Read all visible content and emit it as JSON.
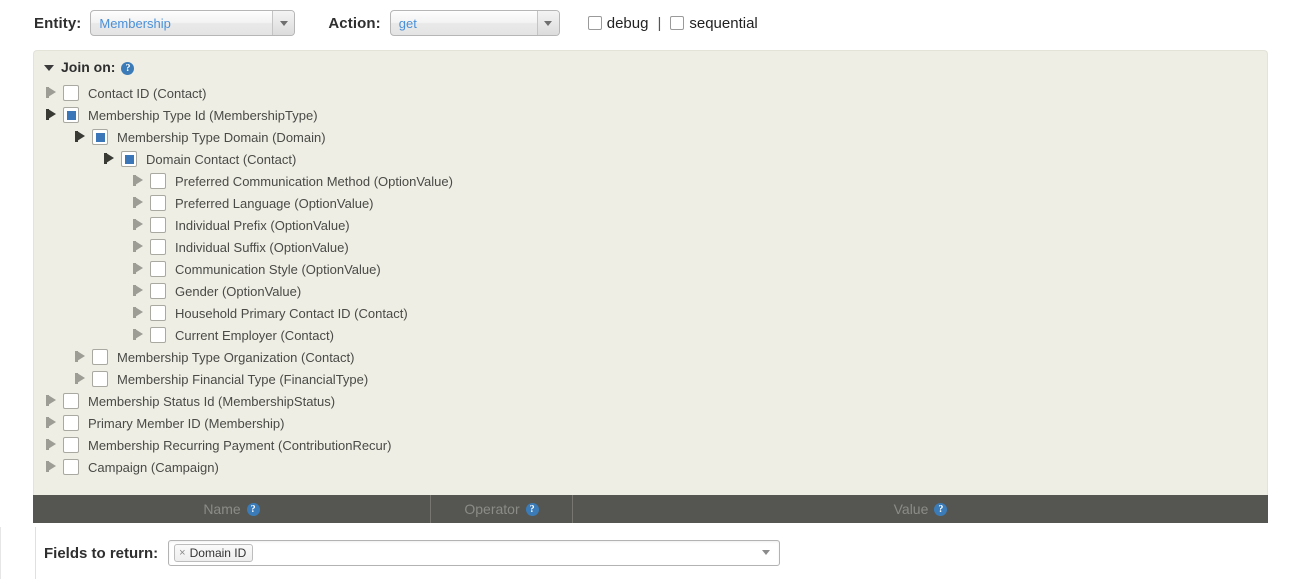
{
  "toolbar": {
    "entity_label": "Entity:",
    "entity_value": "Membership",
    "action_label": "Action:",
    "action_value": "get",
    "debug_label": "debug",
    "separator": "|",
    "sequential_label": "sequential"
  },
  "join_panel": {
    "title": "Join on:",
    "help_glyph": "?",
    "items": [
      {
        "label": "Contact ID (Contact)",
        "depth": 0,
        "checked": false
      },
      {
        "label": "Membership Type Id (MembershipType)",
        "depth": 0,
        "checked": true
      },
      {
        "label": "Membership Type Domain (Domain)",
        "depth": 1,
        "checked": true
      },
      {
        "label": "Domain Contact (Contact)",
        "depth": 2,
        "checked": true
      },
      {
        "label": "Preferred Communication Method (OptionValue)",
        "depth": 3,
        "checked": false
      },
      {
        "label": "Preferred Language (OptionValue)",
        "depth": 3,
        "checked": false
      },
      {
        "label": "Individual Prefix (OptionValue)",
        "depth": 3,
        "checked": false
      },
      {
        "label": "Individual Suffix (OptionValue)",
        "depth": 3,
        "checked": false
      },
      {
        "label": "Communication Style (OptionValue)",
        "depth": 3,
        "checked": false
      },
      {
        "label": "Gender (OptionValue)",
        "depth": 3,
        "checked": false
      },
      {
        "label": "Household Primary Contact ID (Contact)",
        "depth": 3,
        "checked": false
      },
      {
        "label": "Current Employer (Contact)",
        "depth": 3,
        "checked": false
      },
      {
        "label": "Membership Type Organization (Contact)",
        "depth": 1,
        "checked": false
      },
      {
        "label": "Membership Financial Type (FinancialType)",
        "depth": 1,
        "checked": false
      },
      {
        "label": "Membership Status Id (MembershipStatus)",
        "depth": 0,
        "checked": false
      },
      {
        "label": "Primary Member ID (Membership)",
        "depth": 0,
        "checked": false
      },
      {
        "label": "Membership Recurring Payment (ContributionRecur)",
        "depth": 0,
        "checked": false
      },
      {
        "label": "Campaign (Campaign)",
        "depth": 0,
        "checked": false
      }
    ]
  },
  "params_table": {
    "columns": [
      {
        "label": "Name",
        "help_glyph": "?"
      },
      {
        "label": "Operator",
        "help_glyph": "?"
      },
      {
        "label": "Value",
        "help_glyph": "?"
      }
    ]
  },
  "fields_to_return": {
    "label": "Fields to return:",
    "tokens": [
      {
        "label": "Domain ID",
        "remove_glyph": "×"
      }
    ]
  },
  "colors": {
    "accent_blue": "#3a76b8",
    "panel_bg": "#eeeee5",
    "header_bar": "#555551",
    "select_text": "#4a90d9"
  }
}
